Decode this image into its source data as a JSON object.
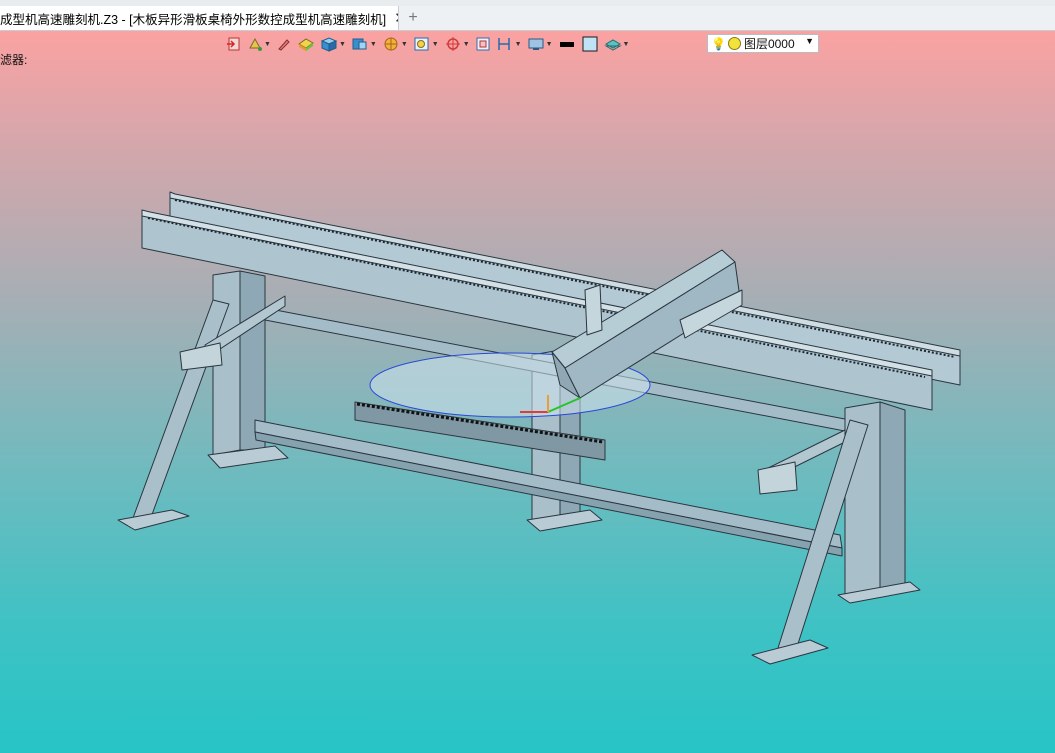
{
  "tabs": {
    "active": "成型机高速雕刻机.Z3 - [木板异形滑板桌椅外形数控成型机高速雕刻机]",
    "close_glyph": "✕",
    "add_glyph": "+"
  },
  "viewport": {
    "filter_label": "滤器:",
    "background_top": "#fba2a2",
    "background_bottom": "#27c4c6"
  },
  "toolbar": {
    "icons": [
      "exit-icon",
      "paint-bucket-icon",
      "pencil-icon",
      "block-shade-icon",
      "cube-icon",
      "view-cube-icon",
      "filter-icon",
      "zoom-window-icon",
      "origin-target-icon",
      "frame-icon",
      "dimension-icon",
      "display-mode-icon",
      "black-color-swatch",
      "light-blue-color-swatch",
      "layer-stack-icon"
    ],
    "layer": {
      "name": "图层0000",
      "bulb_icon": "lightbulb-icon",
      "status_icon": "yellow-circle-icon"
    }
  },
  "model": {
    "name": "木板异形滑板桌椅外形数控成型机高速雕刻机",
    "frame_color": "#b3c9d3",
    "edge_color": "#2a3640"
  }
}
